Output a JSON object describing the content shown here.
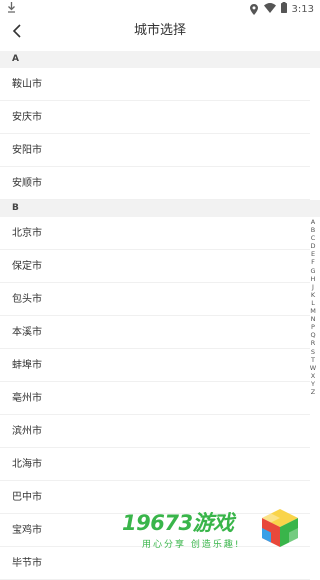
{
  "status_bar": {
    "time": "3:13",
    "download_icon": "download-icon",
    "location_icon": "location-icon",
    "wifi_icon": "wifi-icon",
    "battery_icon": "battery-icon"
  },
  "nav": {
    "title": "城市选择",
    "back_icon": "back-arrow-icon"
  },
  "sections": [
    {
      "letter": "A",
      "cities": [
        "鞍山市",
        "安庆市",
        "安阳市",
        "安顺市"
      ]
    },
    {
      "letter": "B",
      "cities": [
        "北京市",
        "保定市",
        "包头市",
        "本溪市",
        "蚌埠市",
        "亳州市",
        "滨州市",
        "北海市",
        "巴中市",
        "宝鸡市",
        "毕节市"
      ]
    }
  ],
  "index_letters": [
    "A",
    "B",
    "C",
    "D",
    "E",
    "F",
    "G",
    "H",
    "J",
    "K",
    "L",
    "M",
    "N",
    "P",
    "Q",
    "R",
    "S",
    "T",
    "W",
    "X",
    "Y",
    "Z"
  ],
  "watermark": {
    "title": "19673游戏",
    "subtitle": "用心分享 创造乐趣!"
  },
  "colors": {
    "section_bg": "#f2f2f2",
    "watermark_green": "#39b54a"
  }
}
